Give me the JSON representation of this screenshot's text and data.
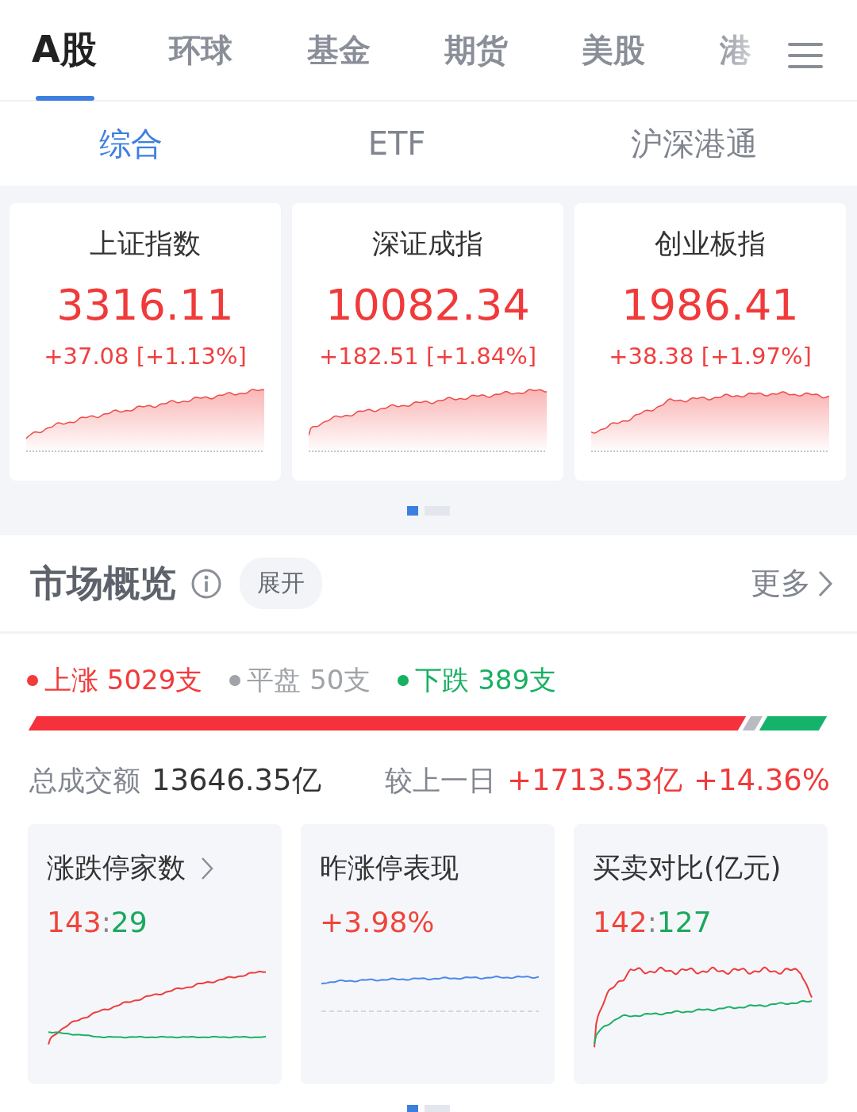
{
  "market_tabs": [
    {
      "label": "A股",
      "selected": true
    },
    {
      "label": "环球",
      "selected": false
    },
    {
      "label": "基金",
      "selected": false
    },
    {
      "label": "期货",
      "selected": false
    },
    {
      "label": "美股",
      "selected": false
    },
    {
      "label": "港",
      "selected": false
    }
  ],
  "sub_tabs": [
    {
      "label": "综合",
      "selected": true
    },
    {
      "label": "ETF",
      "selected": false
    },
    {
      "label": "沪深港通",
      "selected": false
    }
  ],
  "index_cards": [
    {
      "name": "上证指数",
      "value": "3316.11",
      "change": "+37.08 [+1.13%]"
    },
    {
      "name": "深证成指",
      "value": "10082.34",
      "change": "+182.51 [+1.84%]"
    },
    {
      "name": "创业板指",
      "value": "1986.41",
      "change": "+38.38 [+1.97%]"
    }
  ],
  "index_pager": [
    {
      "selected": true
    },
    {
      "selected": false
    }
  ],
  "overview": {
    "title": "市场概览",
    "expand_button": "展开",
    "more_link": "更多",
    "breadth": [
      {
        "kind": "up",
        "label": "上涨 5029支"
      },
      {
        "kind": "flat",
        "label": "平盘 50支"
      },
      {
        "kind": "down",
        "label": "下跌 389支"
      }
    ],
    "turnover_label": "总成交额",
    "turnover_value": "13646.35亿",
    "compare_label": "较上一日",
    "compare_change": "+1713.53亿",
    "compare_percent": "+14.36%"
  },
  "stat_cards": [
    {
      "kind": "ratio",
      "title": "涨跌停家数",
      "has_link": true,
      "up": "143",
      "separator": ":",
      "down": "29"
    },
    {
      "kind": "percent",
      "title": "昨涨停表现",
      "has_link": false,
      "value": "+3.98%"
    },
    {
      "kind": "ratio",
      "title": "买卖对比(亿元)",
      "has_link": false,
      "up": "142",
      "separator": ":",
      "down": "127"
    }
  ],
  "stat_pager": [
    {
      "selected": true
    },
    {
      "selected": false
    }
  ]
}
